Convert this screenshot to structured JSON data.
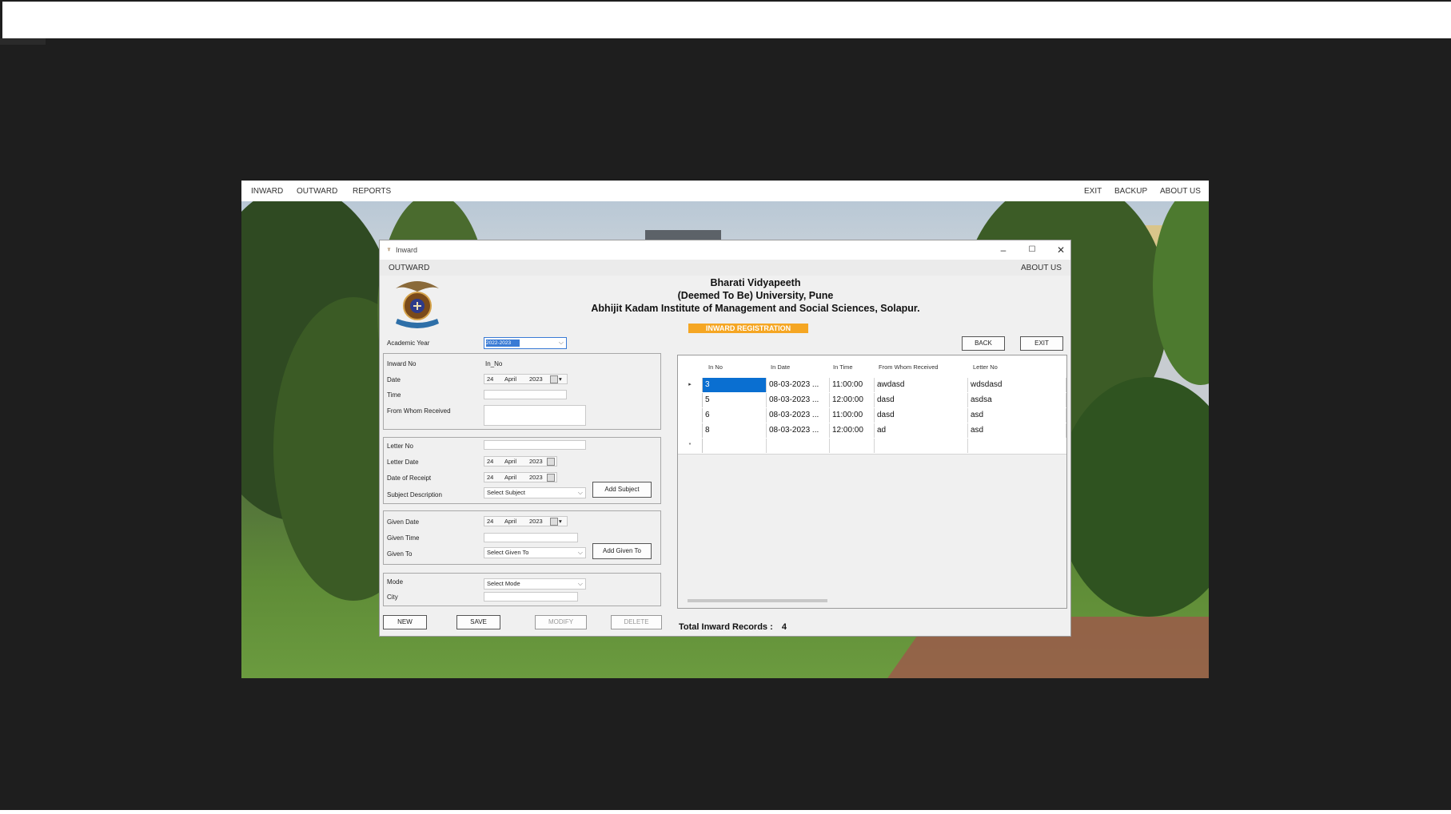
{
  "app": {
    "menu_left": [
      "INWARD",
      "OUTWARD",
      "REPORTS"
    ],
    "menu_right": [
      "EXIT",
      "BACKUP",
      "ABOUT US"
    ]
  },
  "dialog": {
    "title": "Inward",
    "min_icon": "minimize-icon",
    "max_icon": "maximize-icon",
    "close_icon": "close-icon",
    "menu_left": "OUTWARD",
    "menu_right": "ABOUT US",
    "header_line1": "Bharati Vidyapeeth",
    "header_line2": "(Deemed To Be) University, Pune",
    "header_line3": "Abhijit Kadam Institute of Management and Social Sciences, Solapur.",
    "badge": "INWARD REGISTRATION",
    "back_button": "BACK",
    "exit_button": "EXIT"
  },
  "form": {
    "academic_year_label": "Academic Year",
    "academic_year_value": "2022-2023",
    "inward_no_label": "Inward No",
    "inward_no_value": "In_No",
    "date_label": "Date",
    "date": {
      "day": "24",
      "month": "April",
      "year": "2023"
    },
    "time_label": "Time",
    "from_whom_label": "From Whom Received",
    "letter_no_label": "Letter No",
    "letter_date_label": "Letter Date",
    "letter_date": {
      "day": "24",
      "month": "April",
      "year": "2023"
    },
    "receipt_date_label": "Date of Receipt",
    "receipt_date": {
      "day": "24",
      "month": "April",
      "year": "2023"
    },
    "subject_label": "Subject Description",
    "subject_placeholder": "Select Subject",
    "add_subject_button": "Add Subject",
    "given_date_label": "Given Date",
    "given_date": {
      "day": "24",
      "month": "April",
      "year": "2023"
    },
    "given_time_label": "Given Time",
    "given_to_label": "Given To",
    "given_to_placeholder": "Select Given To",
    "add_given_to_button": "Add Given To",
    "mode_label": "Mode",
    "mode_placeholder": "Select Mode",
    "city_label": "City",
    "new_button": "NEW",
    "save_button": "SAVE",
    "modify_button": "MODIFY",
    "delete_button": "DELETE"
  },
  "grid": {
    "columns": [
      "In No",
      "In Date",
      "In Time",
      "From Whom Received",
      "Letter No"
    ],
    "rows": [
      {
        "in_no": "3",
        "in_date": "08-03-2023 ...",
        "in_time": "11:00:00",
        "from": "awdasd",
        "letter": "wdsdasd"
      },
      {
        "in_no": "5",
        "in_date": "08-03-2023 ...",
        "in_time": "12:00:00",
        "from": "dasd",
        "letter": "asdsa"
      },
      {
        "in_no": "6",
        "in_date": "08-03-2023 ...",
        "in_time": "11:00:00",
        "from": "dasd",
        "letter": "asd"
      },
      {
        "in_no": "8",
        "in_date": "08-03-2023 ...",
        "in_time": "12:00:00",
        "from": "ad",
        "letter": "asd"
      }
    ],
    "current_row_marker": "▸",
    "new_row_marker": "*",
    "total_label": "Total Inward Records :",
    "total_value": "4"
  },
  "colors": {
    "badge": "#f5a623",
    "selection": "#0a6fd1"
  }
}
